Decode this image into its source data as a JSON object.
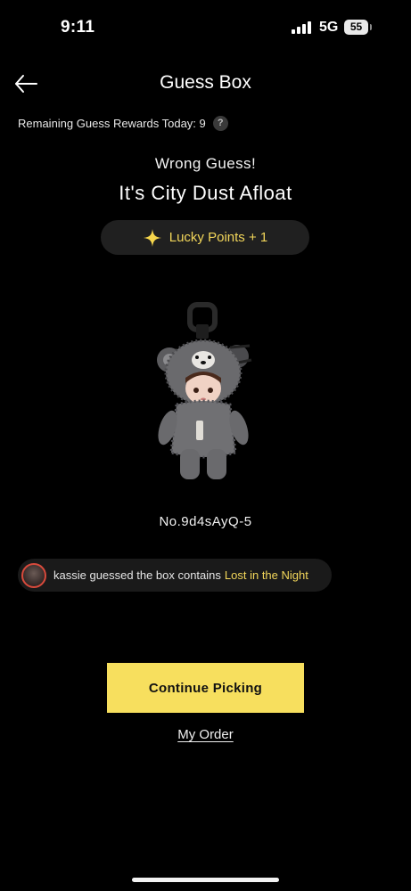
{
  "status_bar": {
    "time": "9:11",
    "network": "5G",
    "battery": "55"
  },
  "header": {
    "title": "Guess Box"
  },
  "rewards": {
    "remaining_label": "Remaining Guess Rewards Today: 9",
    "help_glyph": "?"
  },
  "result": {
    "status": "Wrong Guess!",
    "name": "It's City Dust Afloat"
  },
  "lucky_points": {
    "label": "Lucky Points +  1",
    "icon": "sparkle-star-icon",
    "color": "#f2d65a"
  },
  "item": {
    "serial": "No.9d4sAyQ-5"
  },
  "guess_message": {
    "text": "kassie guessed the box contains",
    "highlight": "Lost in the Night"
  },
  "actions": {
    "continue_label": "Continue Picking",
    "my_order_label": "My Order",
    "accent_color": "#f7df5e"
  }
}
